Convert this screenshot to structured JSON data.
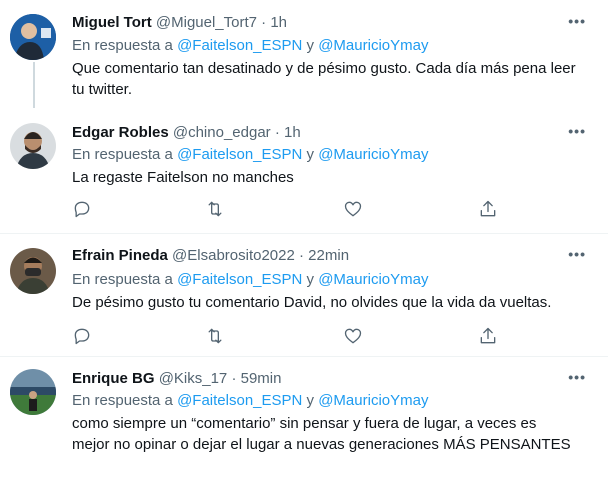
{
  "reply_prefix": "En respuesta a",
  "reply_join": "y",
  "tweets": [
    {
      "name": "Miguel Tort",
      "handle": "@Miguel_Tort7",
      "time": "· 1h",
      "mentions": [
        "@Faitelson_ESPN",
        "@MauricioYmay"
      ],
      "text": "Que comentario tan desatinado y de pésimo gusto. Cada día más pena leer tu twitter."
    },
    {
      "name": "Edgar Robles",
      "handle": "@chino_edgar",
      "time": "· 1h",
      "mentions": [
        "@Faitelson_ESPN",
        "@MauricioYmay"
      ],
      "text": "La regaste Faitelson no manches"
    },
    {
      "name": "Efrain Pineda",
      "handle": "@Elsabrosito2022",
      "time": "· 22min",
      "mentions": [
        "@Faitelson_ESPN",
        "@MauricioYmay"
      ],
      "text": "De pésimo gusto tu comentario David, no olvides que la vida da vueltas."
    },
    {
      "name": "Enrique BG",
      "handle": "@Kiks_17",
      "time": "· 59min",
      "mentions": [
        "@Faitelson_ESPN",
        "@MauricioYmay"
      ],
      "text": "como siempre un “comentario” sin pensar y fuera de lugar, a veces es mejor no opinar o dejar el lugar a nuevas generaciones MÁS PENSANTES"
    }
  ],
  "icons": {
    "more": "more-horizontal-icon",
    "reply": "reply-icon",
    "retweet": "retweet-icon",
    "like": "heart-icon",
    "share": "share-icon"
  },
  "colors": {
    "mention": "#1d9bf0",
    "secondary": "#536471",
    "thread_line": "#cfd9de"
  }
}
